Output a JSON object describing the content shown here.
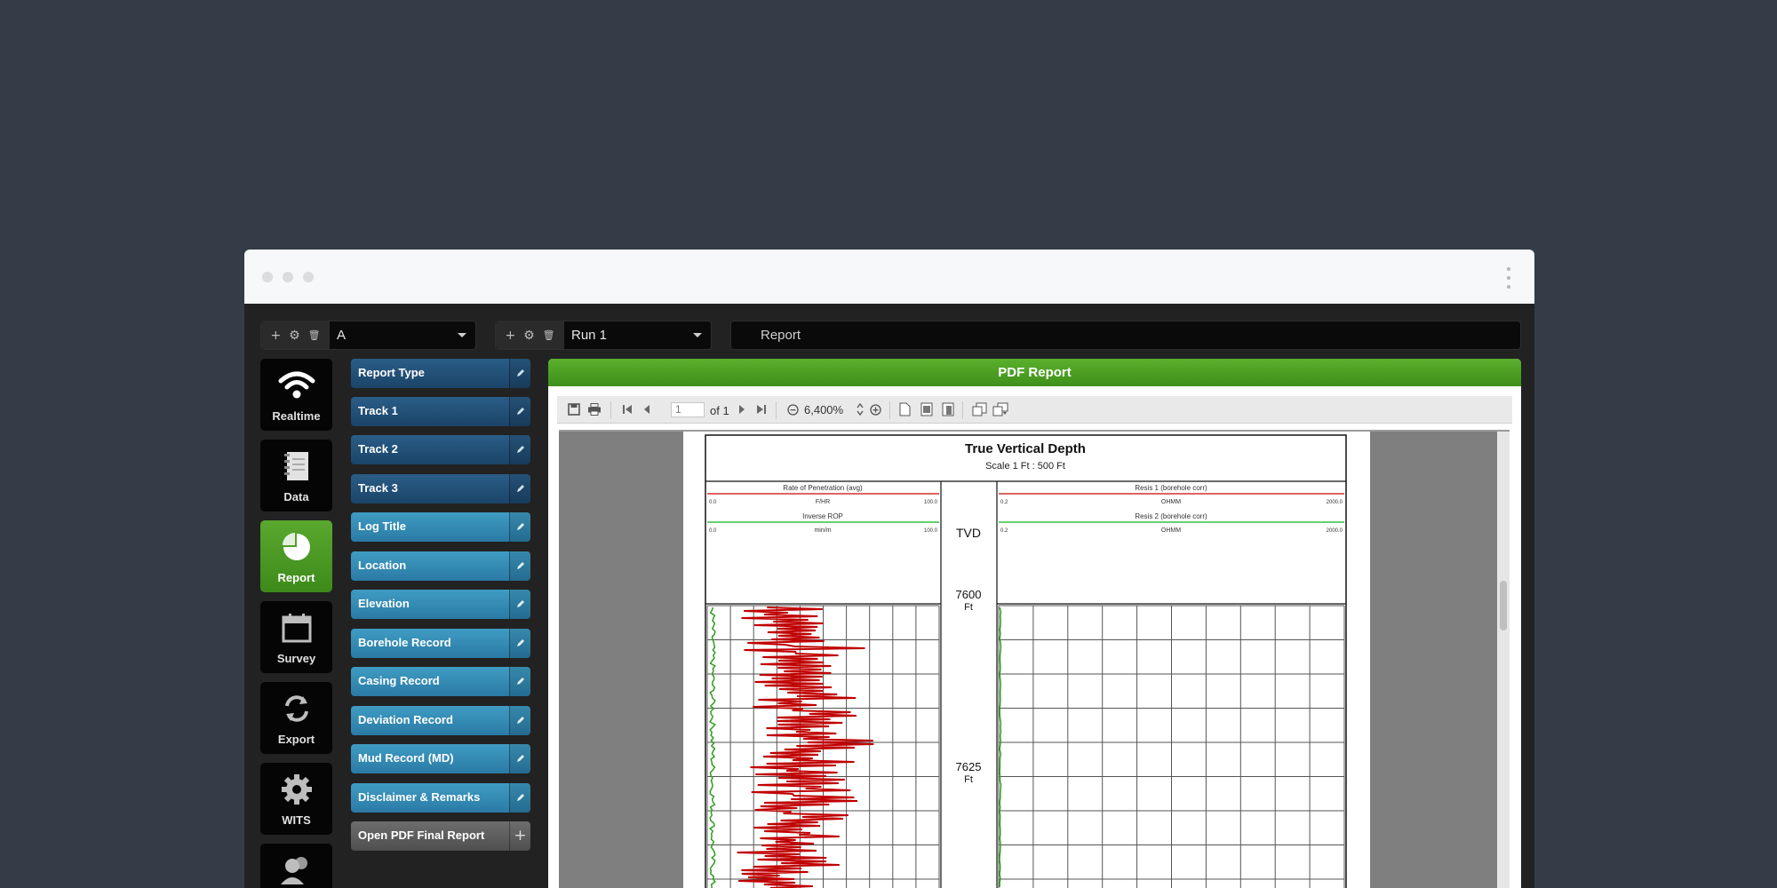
{
  "top_combos": [
    {
      "value": "A",
      "controls": [
        "+",
        "⚙",
        "🗑"
      ]
    },
    {
      "value": "Run 1",
      "controls": [
        "+",
        "⚙",
        "🗑"
      ]
    }
  ],
  "report_bar": {
    "label": "Report"
  },
  "nav": [
    {
      "label": "Realtime",
      "icon": "wifi-icon"
    },
    {
      "label": "Data",
      "icon": "notebook-icon"
    },
    {
      "label": "Report",
      "icon": "pie-chart-icon",
      "active": true
    },
    {
      "label": "Survey",
      "icon": "calendar-icon"
    },
    {
      "label": "Export",
      "icon": "sync-icon"
    },
    {
      "label": "WITS",
      "icon": "gear-icon"
    },
    {
      "label": "",
      "icon": "users-icon"
    }
  ],
  "sections": [
    {
      "label": "Report Type",
      "style": "dark"
    },
    {
      "label": "Track 1",
      "style": "dark"
    },
    {
      "label": "Track 2",
      "style": "dark"
    },
    {
      "label": "Track 3",
      "style": "dark"
    },
    {
      "label": "Log Title",
      "style": "light"
    },
    {
      "label": "Location",
      "style": "light"
    },
    {
      "label": "Elevation",
      "style": "light"
    },
    {
      "label": "Borehole Record",
      "style": "light"
    },
    {
      "label": "Casing Record",
      "style": "light"
    },
    {
      "label": "Deviation Record",
      "style": "light"
    },
    {
      "label": "Mud Record (MD)",
      "style": "light"
    },
    {
      "label": "Disclaimer & Remarks",
      "style": "light"
    },
    {
      "label": "Open PDF Final Report",
      "style": "gray"
    }
  ],
  "pdf": {
    "header": "PDF Report",
    "toolbar": {
      "page": "1",
      "of_pages": "of 1",
      "zoom": "6,400%"
    },
    "page": {
      "title": "True Vertical Depth",
      "scale": "Scale 1 Ft : 500 Ft",
      "center_label": "TVD",
      "track1": [
        {
          "name": "Rate of Penetration (avg)",
          "min": "0.0",
          "unit": "F/HR",
          "max": "100.0"
        },
        {
          "name": "Inverse ROP",
          "min": "0.0",
          "unit": "min/m",
          "max": "100.0"
        }
      ],
      "track2": [
        {
          "name": "Resis 1 (borehole corr)",
          "min": "0.2",
          "unit": "OHMM",
          "max": "2000.0"
        },
        {
          "name": "Resis 2 (borehole corr)",
          "min": "0.2",
          "unit": "OHMM",
          "max": "2000.0"
        }
      ],
      "depth_marks": [
        {
          "value": "7600",
          "unit": "Ft"
        },
        {
          "value": "7625",
          "unit": "Ft"
        }
      ]
    }
  },
  "colors": {
    "green": "#4aa024",
    "red_curve": "#c00000",
    "green_curve": "#2e9e1e"
  }
}
